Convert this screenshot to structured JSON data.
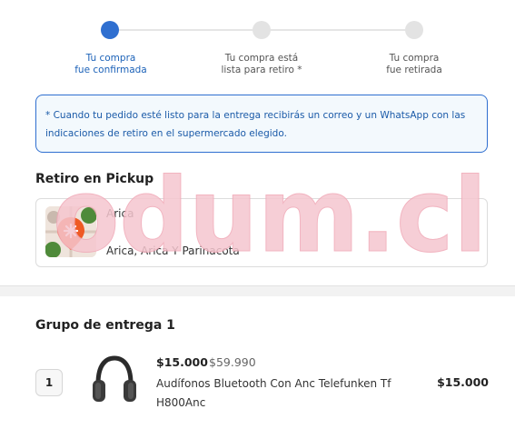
{
  "stepper": {
    "steps": [
      {
        "line1": "Tu compra",
        "line2": "fue confirmada",
        "state": "active"
      },
      {
        "line1": "Tu compra está",
        "line2": "lista para retiro *",
        "state": "pending"
      },
      {
        "line1": "Tu compra",
        "line2": "fue retirada",
        "state": "pending"
      }
    ]
  },
  "notice": {
    "text": "* Cuando tu pedido esté listo para la entrega recibirás un correo y un WhatsApp con las indicaciones de retiro en el supermercado elegido."
  },
  "pickup": {
    "title": "Retiro en Pickup",
    "city": "Arica",
    "region": "Arica, Arica Y Parinacota"
  },
  "watermark": {
    "text": "odum.cl"
  },
  "group": {
    "title": "Grupo de entrega 1",
    "items": [
      {
        "quantity": "1",
        "price_now": "$15.000",
        "price_old": "$59.990",
        "name": "Audífonos Bluetooth Con Anc Telefunken Tf H800Anc",
        "line_total": "$15.000"
      }
    ]
  },
  "colors": {
    "accent": "#2f6fd0",
    "notice_text": "#1a5aa8",
    "watermark": "#f5c6cf"
  }
}
